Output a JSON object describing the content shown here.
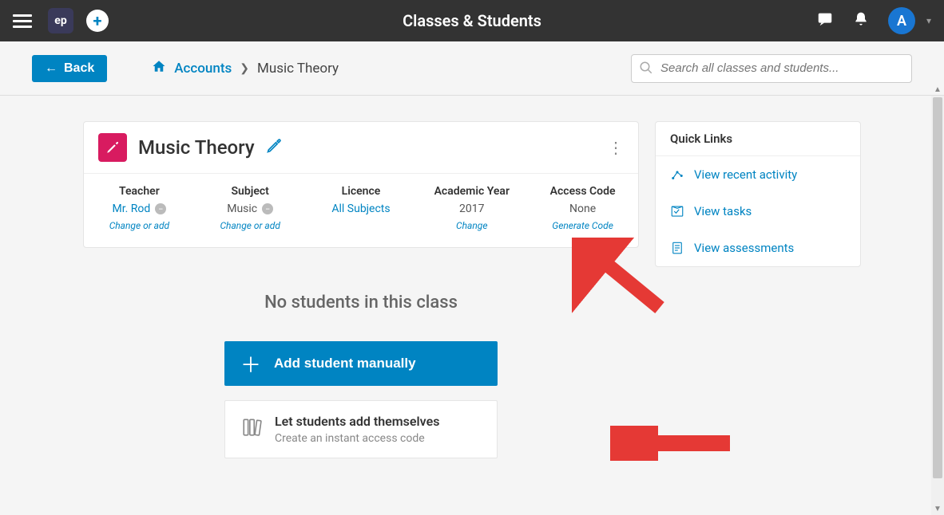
{
  "topbar": {
    "logo": "ep",
    "title": "Classes & Students",
    "avatar_initial": "A"
  },
  "subbar": {
    "back_label": "Back",
    "breadcrumb_root": "Accounts",
    "breadcrumb_current": "Music Theory",
    "search_placeholder": "Search all classes and students..."
  },
  "class_card": {
    "title": "Music Theory",
    "columns": {
      "teacher": {
        "label": "Teacher",
        "value": "Mr. Rod",
        "action": "Change or add"
      },
      "subject": {
        "label": "Subject",
        "value": "Music",
        "action": "Change or add"
      },
      "licence": {
        "label": "Licence",
        "value": "All Subjects"
      },
      "year": {
        "label": "Academic Year",
        "value": "2017",
        "action": "Change"
      },
      "access": {
        "label": "Access Code",
        "value": "None",
        "action": "Generate Code"
      }
    }
  },
  "quick_links": {
    "header": "Quick Links",
    "items": [
      {
        "label": "View recent activity"
      },
      {
        "label": "View tasks"
      },
      {
        "label": "View assessments"
      }
    ]
  },
  "empty_state": "No students in this class",
  "actions": {
    "add_manual": "Add student manually",
    "self_add_title": "Let students add themselves",
    "self_add_subtitle": "Create an instant access code"
  }
}
